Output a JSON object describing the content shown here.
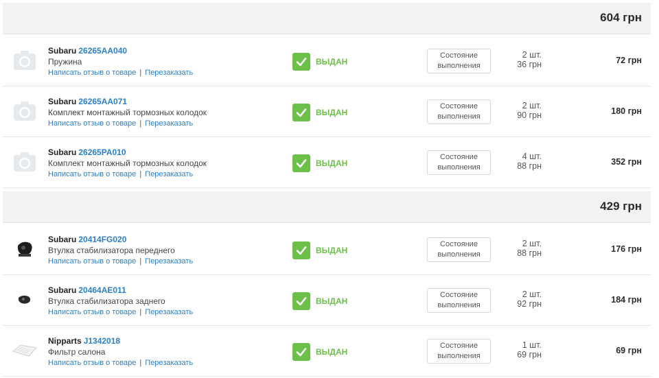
{
  "groups": [
    {
      "total": "604 грн",
      "items": [
        {
          "brand": "Subaru",
          "part_no": "26265AA040",
          "name": "Пружина",
          "review_link": "Написать отзыв о товаре",
          "reorder_link": "Перезаказать",
          "status": "ВЫДАН",
          "state_button": [
            "Состояние",
            "выполнения"
          ],
          "qty": "2 шт.",
          "unit_price": "36 грн",
          "line_total": "72 грн",
          "thumb_icon": "camera-placeholder-icon"
        },
        {
          "brand": "Subaru",
          "part_no": "26265AA071",
          "name": "Комплект монтажный тормозных колодок",
          "review_link": "Написать отзыв о товаре",
          "reorder_link": "Перезаказать",
          "status": "ВЫДАН",
          "state_button": [
            "Состояние",
            "выполнения"
          ],
          "qty": "2 шт.",
          "unit_price": "90 грн",
          "line_total": "180 грн",
          "thumb_icon": "camera-placeholder-icon"
        },
        {
          "brand": "Subaru",
          "part_no": "26265PA010",
          "name": "Комплект монтажный тормозных колодок",
          "review_link": "Написать отзыв о товаре",
          "reorder_link": "Перезаказать",
          "status": "ВЫДАН",
          "state_button": [
            "Состояние",
            "выполнения"
          ],
          "qty": "4 шт.",
          "unit_price": "88 грн",
          "line_total": "352 грн",
          "thumb_icon": "camera-placeholder-icon"
        }
      ]
    },
    {
      "total": "429 грн",
      "items": [
        {
          "brand": "Subaru",
          "part_no": "20414FG020",
          "name": "Втулка стабилизатора переднего",
          "review_link": "Написать отзыв о товаре",
          "reorder_link": "Перезаказать",
          "status": "ВЫДАН",
          "state_button": [
            "Состояние",
            "выполнения"
          ],
          "qty": "2 шт.",
          "unit_price": "88 грн",
          "line_total": "176 грн",
          "thumb_icon": "bushing-photo-icon"
        },
        {
          "brand": "Subaru",
          "part_no": "20464AE011",
          "name": "Втулка стабилизатора заднего",
          "review_link": "Написать отзыв о товаре",
          "reorder_link": "Перезаказать",
          "status": "ВЫДАН",
          "state_button": [
            "Состояние",
            "выполнения"
          ],
          "qty": "2 шт.",
          "unit_price": "92 грн",
          "line_total": "184 грн",
          "thumb_icon": "small-bushing-photo-icon"
        },
        {
          "brand": "Nipparts",
          "part_no": "J1342018",
          "name": "Фильтр салона",
          "review_link": "Написать отзыв о товаре",
          "reorder_link": "Перезаказать",
          "status": "ВЫДАН",
          "state_button": [
            "Состояние",
            "выполнения"
          ],
          "qty": "1 шт.",
          "unit_price": "69 грн",
          "line_total": "69 грн",
          "thumb_icon": "cabin-filter-photo-icon"
        }
      ]
    }
  ],
  "colors": {
    "link": "#2b7fc9",
    "status_green": "#6cc04a",
    "total_bar": "#f2f2f2"
  }
}
